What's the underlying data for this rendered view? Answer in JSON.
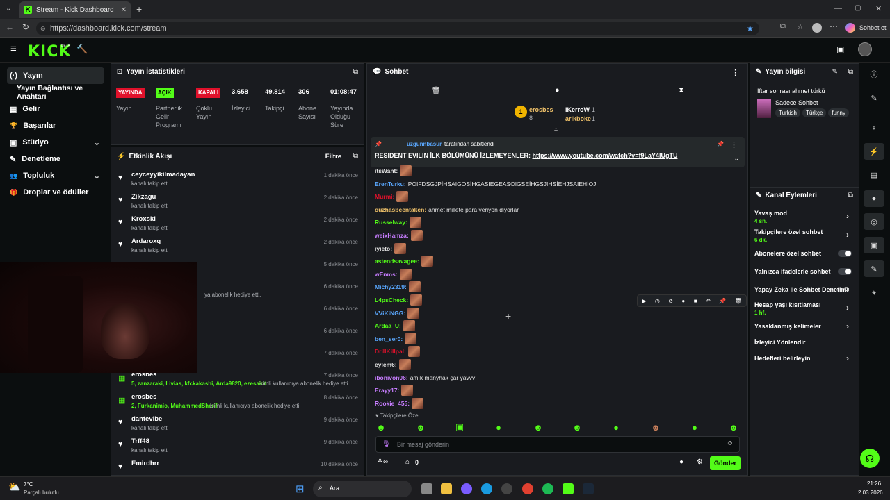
{
  "browser": {
    "tab_title": "Stream - Kick Dashboard",
    "url": "https://dashboard.kick.com/stream",
    "profile_label": "Sohbet et"
  },
  "app": {
    "logo": "KICK",
    "beta": "BETA"
  },
  "nav": [
    {
      "label": "Yayın",
      "icon": "(·)"
    },
    {
      "label": "Yayın Bağlantısı ve Anahtarı",
      "icon": ""
    },
    {
      "label": "Gelir",
      "icon": "▦"
    },
    {
      "label": "Başarılar",
      "icon": "🏆"
    },
    {
      "label": "Stüdyo",
      "icon": "▣"
    },
    {
      "label": "Denetleme",
      "icon": "✎"
    },
    {
      "label": "Topluluk",
      "icon": "👥"
    },
    {
      "label": "Droplar ve ödüller",
      "icon": "🎁"
    }
  ],
  "stats": {
    "title": "Yayın İstatistikleri",
    "badges": [
      {
        "text": "YAYINDA",
        "color": "#e0112b",
        "label": "Yayın"
      },
      {
        "text": "AÇIK",
        "color": "#53fc18",
        "label": "Partnerlik Gelir Programı"
      },
      {
        "text": "KAPALI",
        "color": "#e0112b",
        "label": "Çoklu Yayın"
      }
    ],
    "values": [
      {
        "value": "3.658",
        "label": "İzleyici"
      },
      {
        "value": "49.814",
        "label": "Takipçi"
      },
      {
        "value": "306",
        "label": "Abone Sayısı"
      },
      {
        "value": "01:08:47",
        "label": "Yayında Olduğu Süre"
      }
    ]
  },
  "activity": {
    "title": "Etkinlik Akışı",
    "filter": "Filtre",
    "items": [
      {
        "name": "ceyceyyikilmadayan",
        "sub": "kanalı takip etti",
        "time": "1 dakika önce"
      },
      {
        "name": "Zikzagu",
        "sub": "kanalı takip etti",
        "time": "2 dakika önce"
      },
      {
        "name": "Kroxski",
        "sub": "kanalı takip etti",
        "time": "2 dakika önce"
      },
      {
        "name": "Ardaroxq",
        "sub": "kanalı takip etti",
        "time": "2 dakika önce"
      },
      {
        "name": "",
        "sub": "",
        "time": "5 dakika önce"
      },
      {
        "name": "",
        "sub": "ya abonelik hediye etti.",
        "time": "6 dakika önce"
      },
      {
        "name": "",
        "sub": "",
        "time": "6 dakika önce"
      },
      {
        "name": "",
        "sub": "",
        "time": "6 dakika önce"
      },
      {
        "name": "",
        "sub": "",
        "time": "7 dakika önce"
      }
    ],
    "gift1": {
      "name": "erosbes",
      "users": "5, zanzaraki, Livias, kfckakashi, Arda9820, ezesaint",
      "suffix": "isimli kullanıcıya abonelik hediye etti.",
      "time": "7 dakika önce"
    },
    "gift2": {
      "name": "erosbes",
      "users": "2, Furkanimio, MuhammedSherif",
      "suffix": "isimli kullanıcıya abonelik hediye etti.",
      "time": "8 dakika önce"
    },
    "tail": [
      {
        "name": "dantevibe",
        "sub": "kanalı takip etti",
        "time": "9 dakika önce"
      },
      {
        "name": "Trff48",
        "sub": "kanalı takip etti",
        "time": "9 dakika önce"
      },
      {
        "name": "Emirdhrr",
        "sub": "",
        "time": "10 dakika önce"
      }
    ]
  },
  "chat": {
    "title": "Sohbet",
    "top": [
      {
        "name": "erosbes",
        "count": "8",
        "rank": "1"
      },
      {
        "name": "iKerroW",
        "count": "1"
      },
      {
        "name": "arikboke",
        "count": "1"
      }
    ],
    "pinned": {
      "by": "uzgunnbasur",
      "by_suffix": "tarafından sabitlendi",
      "text": "RESIDENT EVILIN İLK BÖLÜMÜNÜ İZLEMEYENLER: ",
      "link": "https://www.youtube.com/watch?v=f9LaY4lUgTU"
    },
    "messages": [
      {
        "user": "itsWant:",
        "color": "#e5e5e5",
        "text": "",
        "emote": true
      },
      {
        "user": "ErenTurku:",
        "color": "#5aa8ff",
        "text": "POIFDSGJPİHSAIGOSİHGASIEGEASOIGSEİHGSJIHSİEHJSAIEHİOJ",
        "emote": false
      },
      {
        "user": "Murmi:",
        "color": "#e0112b",
        "text": "",
        "emote": true
      },
      {
        "user": "ouzhasbeentaken:",
        "color": "#f0c26a",
        "text": "ahmet millete para veriyon diyorlar",
        "emote": false
      },
      {
        "user": "Russelway:",
        "color": "#53fc18",
        "text": "",
        "emote": true
      },
      {
        "user": "weixHamza:",
        "color": "#c77dff",
        "text": "",
        "emote": true
      },
      {
        "user": "iyieto:",
        "color": "#e5e5e5",
        "text": "",
        "emote": true
      },
      {
        "user": "astendsavagee:",
        "color": "#53fc18",
        "text": "",
        "emote": true
      },
      {
        "user": "wEnms:",
        "color": "#c77dff",
        "text": "",
        "emote": true
      },
      {
        "user": "Michy2319:",
        "color": "#5aa8ff",
        "text": "",
        "emote": true
      },
      {
        "user": "L4psCheck:",
        "color": "#53fc18",
        "text": "",
        "emote": true
      },
      {
        "user": "VViKiNGG:",
        "color": "#5aa8ff",
        "text": "",
        "emote": true
      },
      {
        "user": "Ardaa_U:",
        "color": "#53fc18",
        "text": "",
        "emote": true
      },
      {
        "user": "ben_ser0:",
        "color": "#5aa8ff",
        "text": "",
        "emote": true
      },
      {
        "user": "DrillKillpal:",
        "color": "#e0112b",
        "text": "",
        "emote": true
      },
      {
        "user": "eylem6:",
        "color": "#e5e5e5",
        "text": "",
        "emote": true
      },
      {
        "user": "ibonivon06:",
        "color": "#c77dff",
        "text": "amık manyhak çar yavvv",
        "emote": false
      },
      {
        "user": "Erayy17:",
        "color": "#c77dff",
        "text": "",
        "emote": true
      },
      {
        "user": "Rookie_455:",
        "color": "#c77dff",
        "text": "",
        "emote": true
      }
    ],
    "followers_only": "Takipçilere Özel",
    "input_placeholder": "Bir mesaj gönderin",
    "send": "Gönder",
    "viewer_count": "0"
  },
  "info": {
    "title": "Yayın bilgisi",
    "stream_title": "İftar sonrası ahmet türkü",
    "category": "Sadece Sohbet",
    "tags": [
      "Turkish",
      "Türkçe",
      "funny"
    ]
  },
  "actions": {
    "title": "Kanal Eylemleri",
    "items": [
      {
        "label": "Yavaş mod",
        "sub": "4 sn.",
        "type": "chev"
      },
      {
        "label": "Takipçilere özel sohbet",
        "sub": "6 dk.",
        "type": "chev"
      },
      {
        "label": "Abonelere özel sohbet",
        "sub": "",
        "type": "toggle"
      },
      {
        "label": "Yalnızca ifadelerle sohbet",
        "sub": "",
        "type": "toggle"
      },
      {
        "label": "Yapay Zeka ile Sohbet Denetimi",
        "sub": "",
        "type": "ext"
      },
      {
        "label": "Hesap yaşı kısıtlaması",
        "sub": "1 hf.",
        "type": "chev"
      },
      {
        "label": "Yasaklanmış kelimeler",
        "sub": "",
        "type": "chev"
      },
      {
        "label": "İzleyici Yönlendir",
        "sub": "",
        "type": "none"
      },
      {
        "label": "Hedefleri belirleyin",
        "sub": "",
        "type": "chev"
      }
    ]
  },
  "taskbar": {
    "temp": "7°C",
    "weather": "Parçalı bulutlu",
    "search": "Ara",
    "time": "21:26",
    "date": "2.03.2026"
  }
}
